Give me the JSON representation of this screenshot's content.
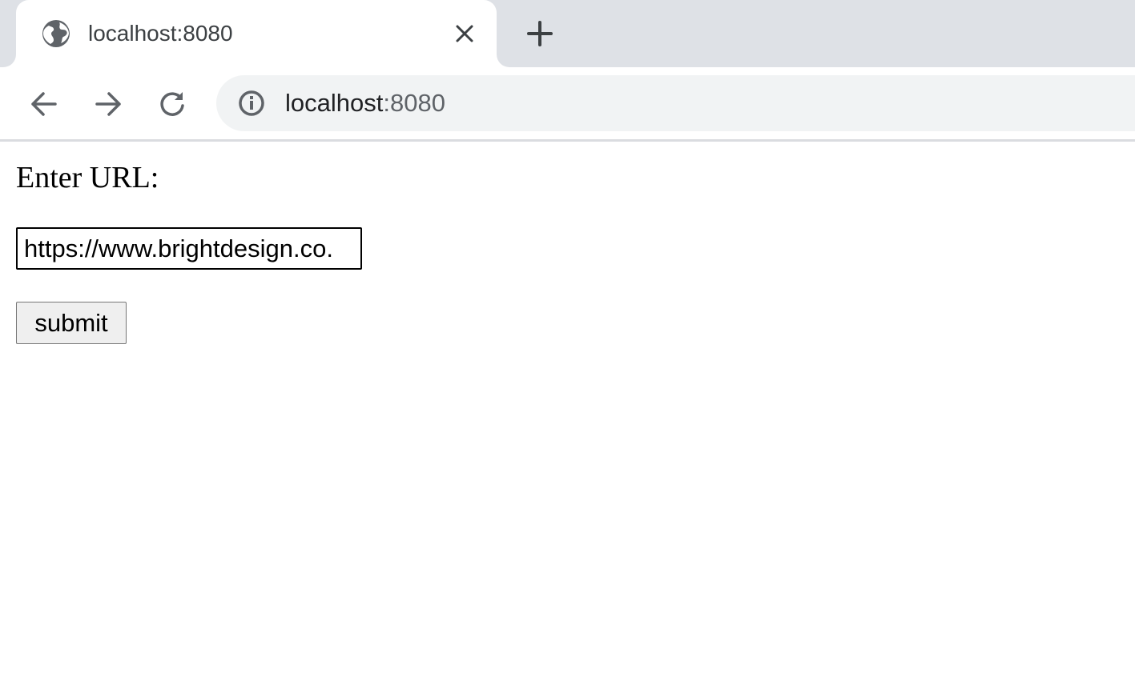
{
  "browser": {
    "tab": {
      "title": "localhost:8080",
      "favicon": "globe-icon",
      "close_icon": "close-icon"
    },
    "new_tab_icon": "plus-icon",
    "nav": {
      "back_icon": "arrow-left-icon",
      "forward_icon": "arrow-right-icon",
      "reload_icon": "reload-icon"
    },
    "omnibox": {
      "info_icon": "info-icon",
      "host": "localhost",
      "port": ":8080"
    }
  },
  "page": {
    "label": "Enter URL:",
    "url_input_value": "https://www.brightdesign.co.",
    "submit_label": "submit"
  },
  "colors": {
    "tabstrip_bg": "#dee1e6",
    "omnibox_bg": "#f1f3f4",
    "icon_color": "#5f6368",
    "text_primary": "#202124"
  }
}
